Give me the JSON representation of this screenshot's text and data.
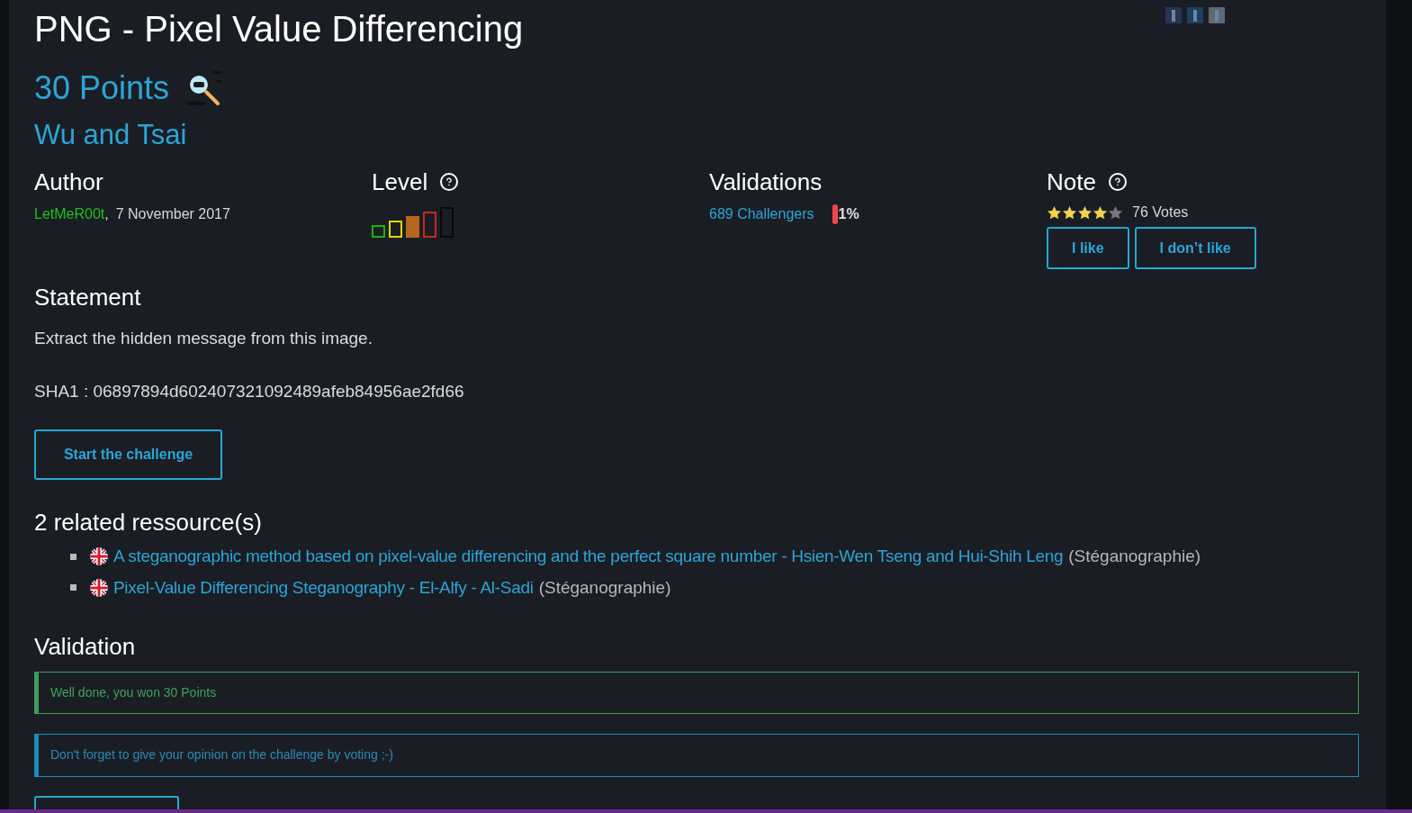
{
  "title": "PNG - Pixel Value Differencing",
  "points": "30 Points",
  "subtitle": "Wu and Tsai",
  "author": {
    "heading": "Author",
    "name": "LetMeR00t",
    "separator": ",",
    "date": "7 November 2017"
  },
  "level": {
    "heading": "Level",
    "bars": [
      {
        "color": "#19b30f",
        "selected": false
      },
      {
        "color": "#e2d600",
        "selected": false
      },
      {
        "color": "#b5651d",
        "selected": true
      },
      {
        "color": "#c42a1a",
        "selected": false
      },
      {
        "color": "#0a0a0a",
        "selected": false
      }
    ]
  },
  "validations": {
    "heading": "Validations",
    "challengers": "689 Challengers",
    "percent": "1%"
  },
  "note": {
    "heading": "Note",
    "stars": 4,
    "votes": "76 Votes",
    "buttons": [
      "I like",
      "I don’t like"
    ]
  },
  "statement": {
    "heading": "Statement",
    "lines": [
      "Extract the hidden message from this image.",
      "SHA1 : 06897894d602407321092489afeb84956ae2fd66"
    ],
    "button": "Start the challenge"
  },
  "resources": {
    "heading": "2 related ressource(s)",
    "items": [
      {
        "link": "A steganographic method based on pixel-value differencing and the perfect square number - Hsien-Wen Tseng and Hui-Shih Leng",
        "category": "(Stéganographie)"
      },
      {
        "link": "Pixel-Value Differencing Steganography - El-Alfy - Al-Sadi",
        "category": "(Stéganographie)"
      }
    ]
  },
  "validation": {
    "heading": "Validation",
    "messages": [
      {
        "kind": "success",
        "text": "Well done, you won 30 Points"
      },
      {
        "kind": "info",
        "text": "Don't forget to give your opinion on the challenge by voting ;-)"
      }
    ]
  }
}
